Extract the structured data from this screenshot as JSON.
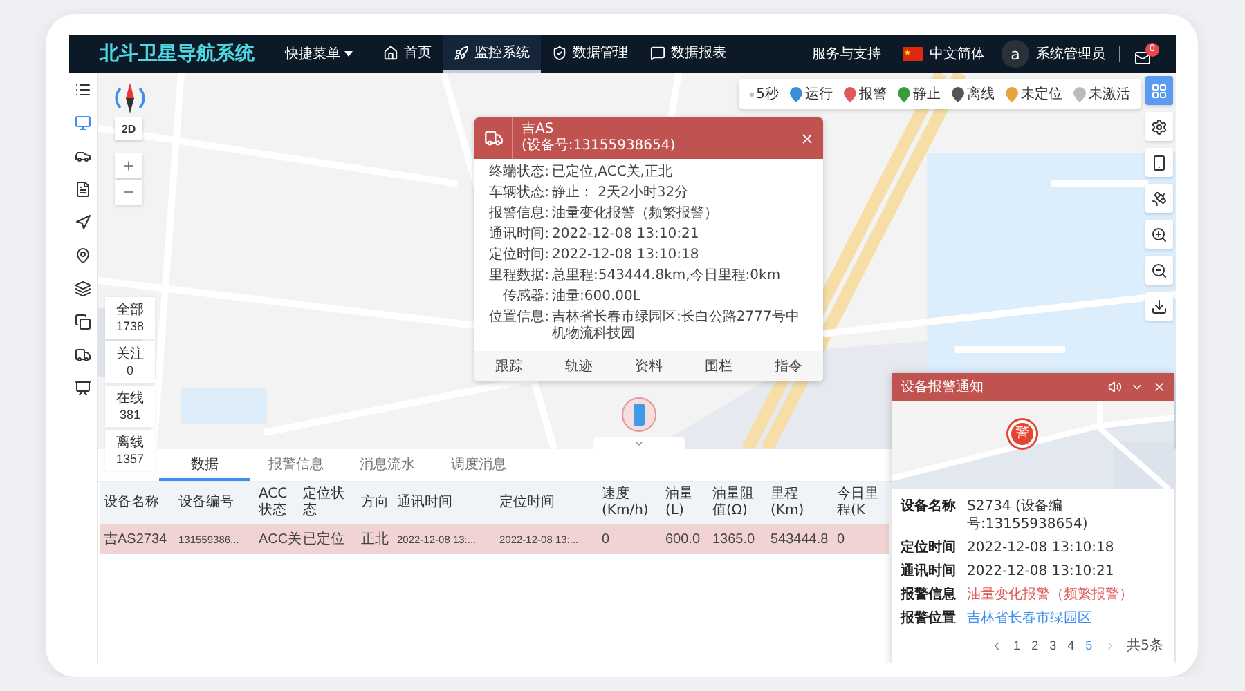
{
  "nav": {
    "logo": "北斗卫星导航系统",
    "menu": "快捷菜单",
    "items": [
      {
        "kind": "home",
        "label": "首页",
        "selected": false
      },
      {
        "kind": "monitor",
        "label": "监控系统",
        "selected": true
      },
      {
        "kind": "data",
        "label": "数据管理",
        "selected": false
      },
      {
        "kind": "report",
        "label": "数据报表",
        "selected": false
      }
    ],
    "support": "服务与支持",
    "language": "中文简体",
    "avatar": "a",
    "user": "系统管理员",
    "mail_badge": "0"
  },
  "sidebar": {
    "items": [
      {
        "kind": "menu",
        "selected": false
      },
      {
        "kind": "monitor",
        "selected": true
      },
      {
        "kind": "car",
        "selected": false
      },
      {
        "kind": "report",
        "selected": false
      },
      {
        "kind": "route",
        "selected": false
      },
      {
        "kind": "location",
        "selected": false
      },
      {
        "kind": "layers",
        "selected": false
      },
      {
        "kind": "copy",
        "selected": false
      },
      {
        "kind": "truck",
        "selected": false
      },
      {
        "kind": "screen",
        "selected": false
      }
    ]
  },
  "map": {
    "view_mode": "2D",
    "refresh": "5秒",
    "legend": [
      {
        "label": "运行",
        "color": "#3b8fd9"
      },
      {
        "label": "报警",
        "color": "#e05a5a"
      },
      {
        "label": "静止",
        "color": "#3a9a3a"
      },
      {
        "label": "离线",
        "color": "#555555"
      },
      {
        "label": "未定位",
        "color": "#e8a33d"
      },
      {
        "label": "未激活",
        "color": "#bbbbbb"
      }
    ],
    "toolbar": [
      {
        "kind": "grid",
        "selected": true
      },
      {
        "kind": "settings",
        "selected": false
      },
      {
        "kind": "device",
        "selected": false
      },
      {
        "kind": "satellite",
        "selected": false
      },
      {
        "kind": "zoom-in",
        "selected": false
      },
      {
        "kind": "zoom-out",
        "selected": false
      },
      {
        "kind": "export",
        "selected": false
      }
    ],
    "counts": [
      {
        "label": "全部",
        "value": "1738"
      },
      {
        "label": "关注",
        "value": "0"
      },
      {
        "label": "在线",
        "value": "381"
      },
      {
        "label": "离线",
        "value": "1357"
      }
    ]
  },
  "popup": {
    "title": "吉AS",
    "device": "(设备号:13155938654)",
    "fields": [
      {
        "label": "终端状态:",
        "value": "已定位,ACC关,正北"
      },
      {
        "label": "车辆状态:",
        "value": "静止： 2天2小时32分"
      },
      {
        "label": "报警信息:",
        "value": "油量变化报警（频繁报警）"
      },
      {
        "label": "通讯时间:",
        "value": "2022-12-08 13:10:21"
      },
      {
        "label": "定位时间:",
        "value": "2022-12-08 13:10:18"
      },
      {
        "label": "里程数据:",
        "value": "总里程:543444.8km,今日里程:0km"
      },
      {
        "label": "传感器:",
        "value": "油量:600.00L"
      },
      {
        "label": "位置信息:",
        "value": "吉林省长春市绿园区:长白公路2777号中机物流科技园"
      }
    ],
    "actions": [
      "跟踪",
      "轨迹",
      "资料",
      "围栏",
      "指令"
    ]
  },
  "bottom": {
    "tabs": [
      {
        "label": "数据",
        "selected": true
      },
      {
        "label": "报警信息",
        "selected": false
      },
      {
        "label": "消息流水",
        "selected": false
      },
      {
        "label": "调度消息",
        "selected": false
      }
    ],
    "columns": [
      "设备名称",
      "设备编号",
      "ACC状态",
      "定位状态",
      "方向",
      "通讯时间",
      "定位时间",
      "速度(Km/h)",
      "油量(L)",
      "油量阻值(Ω)",
      "里程(Km)",
      "今日里程(K"
    ],
    "rows": [
      {
        "selected": true,
        "cells": [
          "吉AS2734",
          "131559386...",
          "ACC关",
          "已定位",
          "正北",
          "2022-12-08 13:...",
          "2022-12-08 13:...",
          "0",
          "600.0",
          "1365.0",
          "543444.8",
          "0"
        ]
      }
    ]
  },
  "alarm_panel": {
    "title": "设备报警通知",
    "marker": "警",
    "fields": [
      {
        "kind": "plain",
        "label": "设备名称",
        "value": "S2734 (设备编号:13155938654)"
      },
      {
        "kind": "plain",
        "label": "定位时间",
        "value": "2022-12-08 13:10:18"
      },
      {
        "kind": "plain",
        "label": "通讯时间",
        "value": "2022-12-08 13:10:21"
      },
      {
        "kind": "alert",
        "label": "报警信息",
        "value": "油量变化报警（频繁报警）"
      },
      {
        "kind": "link",
        "label": "报警位置",
        "value": "吉林省长春市绿园区"
      }
    ],
    "pages": [
      {
        "label": "1",
        "selected": false
      },
      {
        "label": "2",
        "selected": false
      },
      {
        "label": "3",
        "selected": false
      },
      {
        "label": "4",
        "selected": false
      },
      {
        "label": "5",
        "selected": true
      }
    ],
    "total": "共5条"
  }
}
